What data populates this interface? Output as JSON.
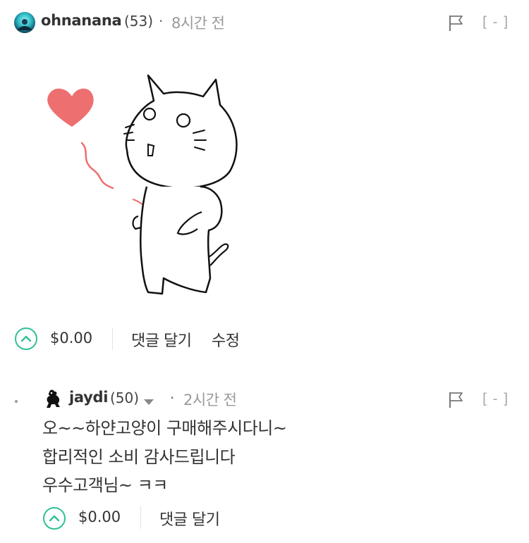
{
  "comment": {
    "author": "ohnanana",
    "reputation": "(53)",
    "separator": "·",
    "time": "8시간 전",
    "collapse": "[-]",
    "payout": "$0.00",
    "actions": {
      "reply": "댓글 달기",
      "edit": "수정"
    }
  },
  "reply": {
    "author": "jaydi",
    "reputation": "(50)",
    "separator": "·",
    "time": "2시간 전",
    "collapse": "[-]",
    "lines": [
      "오~~하얀고양이 구매해주시다니~",
      "합리적인 소비 감사드립니다",
      "우수고객님~ ㅋㅋ"
    ],
    "payout": "$0.00",
    "actions": {
      "reply": "댓글 달기"
    }
  },
  "icons": {
    "upvote": "chevron-up-circle-icon",
    "flag": "flag-icon",
    "dropdown": "caret-down-icon"
  },
  "colors": {
    "upvote_accent": "#2fc097",
    "heart": "#ee6f6f",
    "muted": "#999999"
  }
}
